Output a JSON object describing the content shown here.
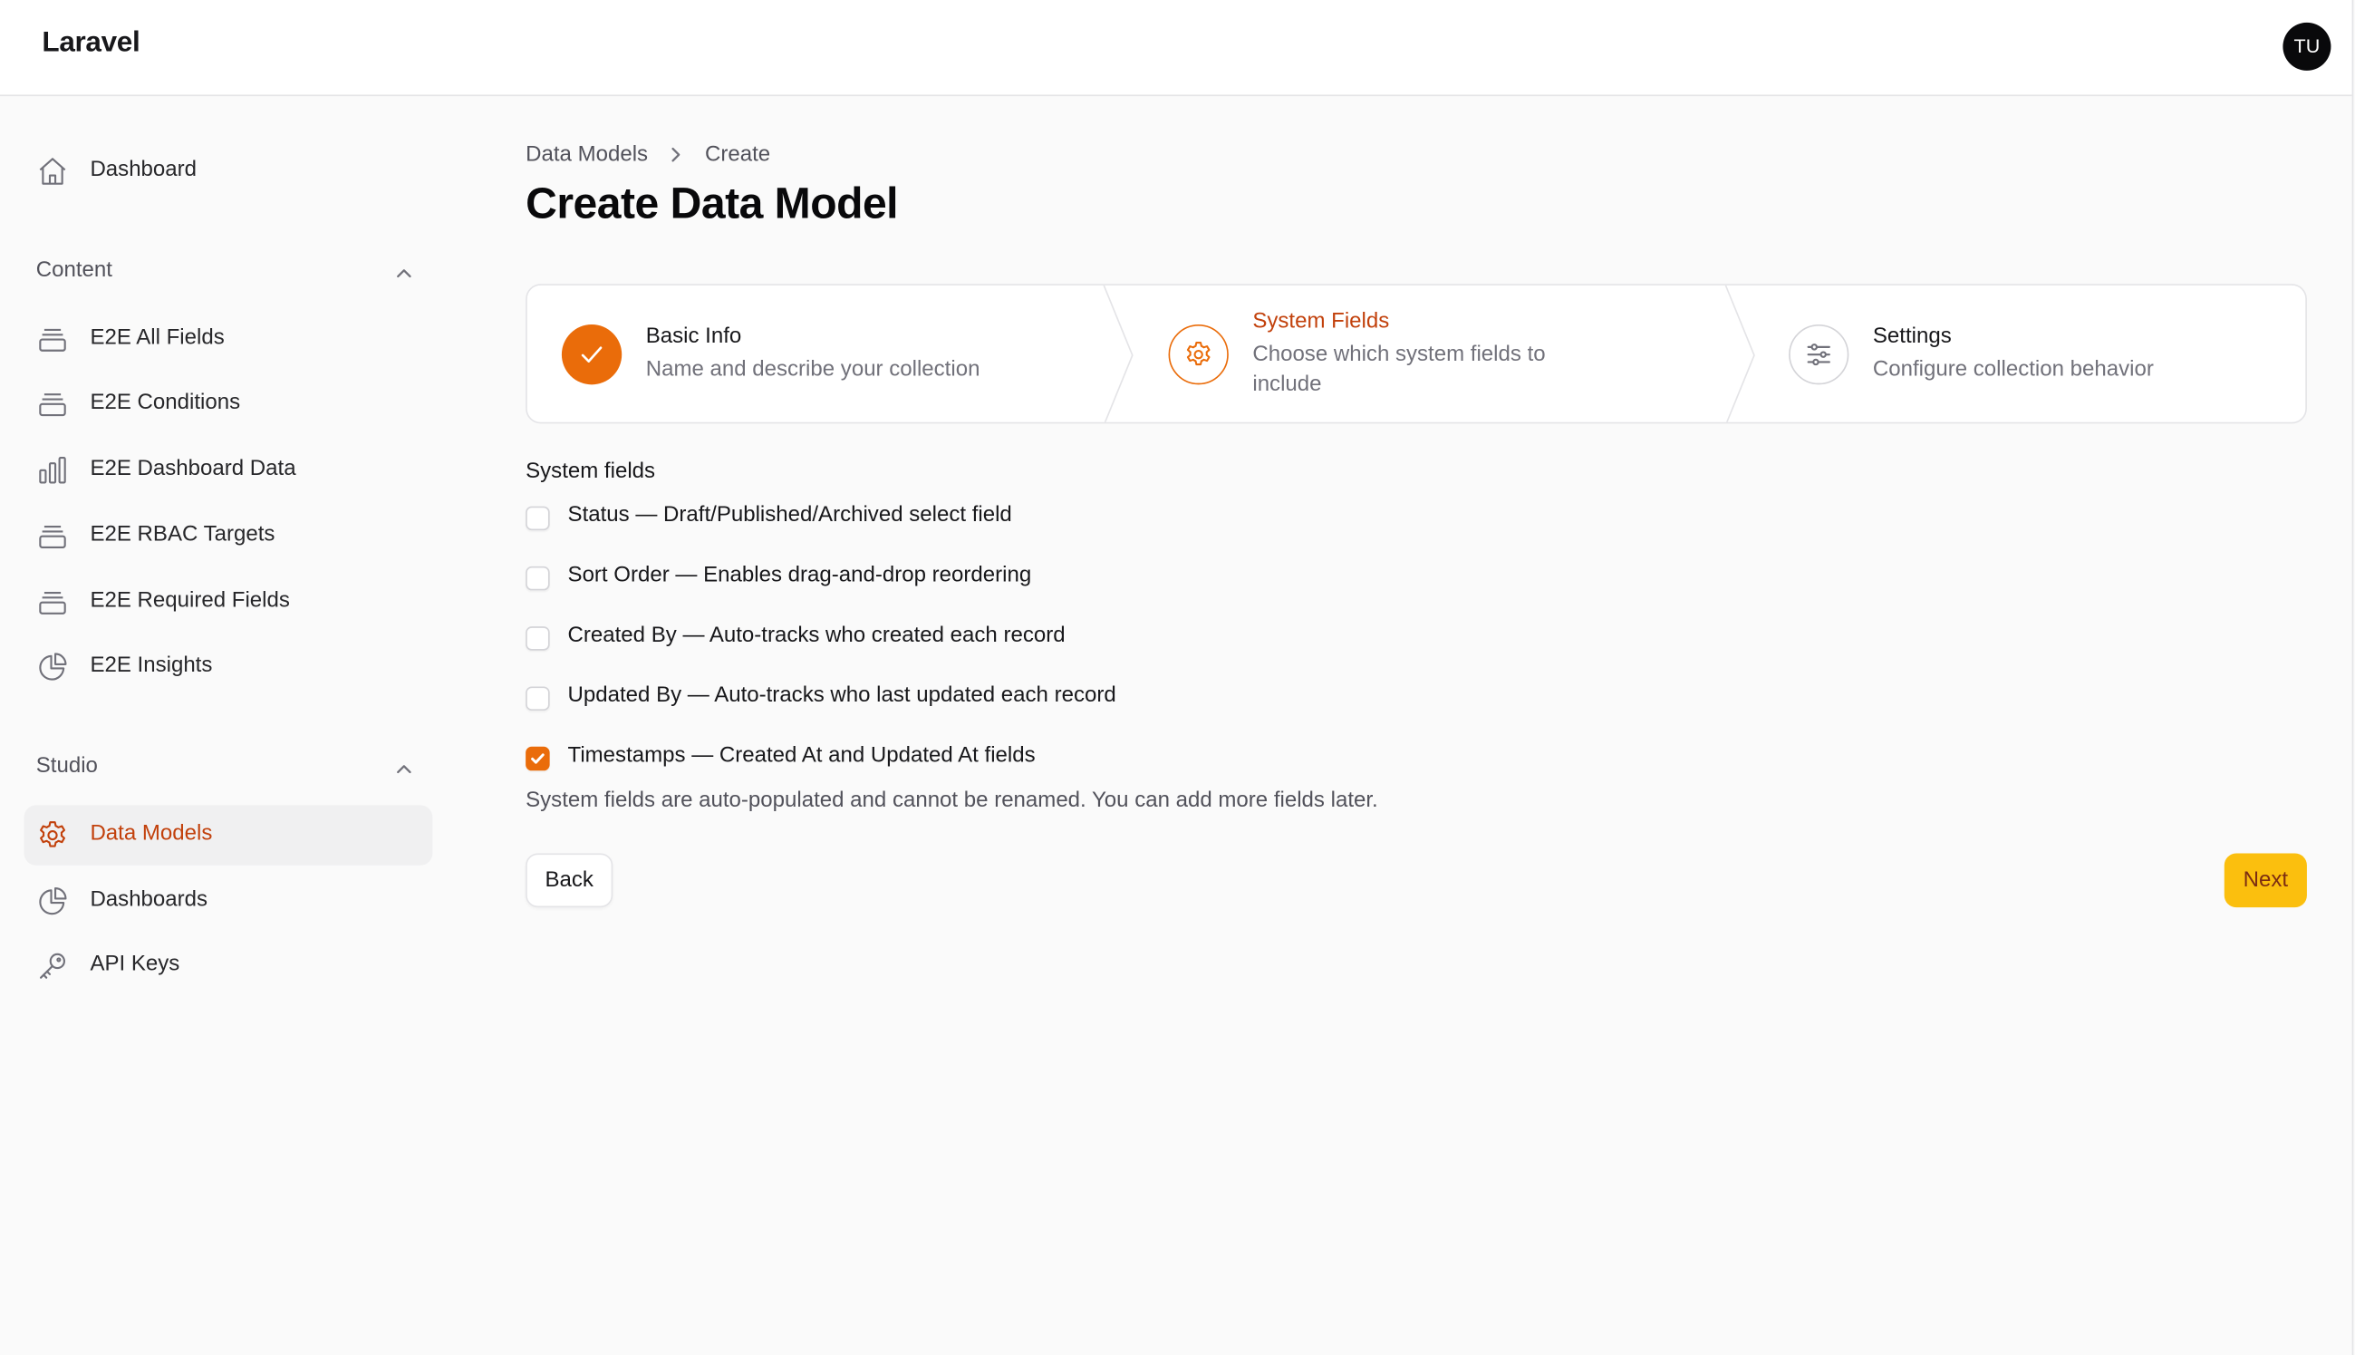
{
  "header": {
    "brand": "Laravel",
    "avatar_initials": "TU"
  },
  "sidebar": {
    "dashboard": {
      "label": "Dashboard",
      "icon": "home-icon"
    },
    "sections": [
      {
        "title": "Content",
        "expanded": true,
        "items": [
          {
            "label": "E2E All Fields",
            "icon": "stack-icon"
          },
          {
            "label": "E2E Conditions",
            "icon": "stack-icon"
          },
          {
            "label": "E2E Dashboard Data",
            "icon": "bar-chart-icon"
          },
          {
            "label": "E2E RBAC Targets",
            "icon": "stack-icon"
          },
          {
            "label": "E2E Required Fields",
            "icon": "stack-icon"
          },
          {
            "label": "E2E Insights",
            "icon": "pie-chart-icon"
          }
        ]
      },
      {
        "title": "Studio",
        "expanded": true,
        "items": [
          {
            "label": "Data Models",
            "icon": "gear-icon",
            "active": true
          },
          {
            "label": "Dashboards",
            "icon": "pie-chart-icon"
          },
          {
            "label": "API Keys",
            "icon": "key-icon"
          }
        ]
      }
    ]
  },
  "breadcrumb": {
    "items": [
      "Data Models",
      "Create"
    ]
  },
  "page": {
    "title": "Create Data Model"
  },
  "steps": [
    {
      "title": "Basic Info",
      "description": "Name and describe your collection",
      "state": "complete"
    },
    {
      "title": "System Fields",
      "description": "Choose which system fields to include",
      "state": "current"
    },
    {
      "title": "Settings",
      "description": "Configure collection behavior",
      "state": "upcoming"
    }
  ],
  "system_fields": {
    "heading": "System fields",
    "options": [
      {
        "label": "Status — Draft/Published/Archived select field",
        "checked": false
      },
      {
        "label": "Sort Order — Enables drag-and-drop reordering",
        "checked": false
      },
      {
        "label": "Created By — Auto-tracks who created each record",
        "checked": false
      },
      {
        "label": "Updated By — Auto-tracks who last updated each record",
        "checked": false
      },
      {
        "label": "Timestamps — Created At and Updated At fields",
        "checked": true
      }
    ],
    "helper": "System fields are auto-populated and cannot be renamed. You can add more fields later."
  },
  "actions": {
    "back_label": "Back",
    "next_label": "Next"
  },
  "colors": {
    "accent": "#ea6c0a",
    "active_text": "#c2410c",
    "next_button": "#fbbf0e"
  }
}
